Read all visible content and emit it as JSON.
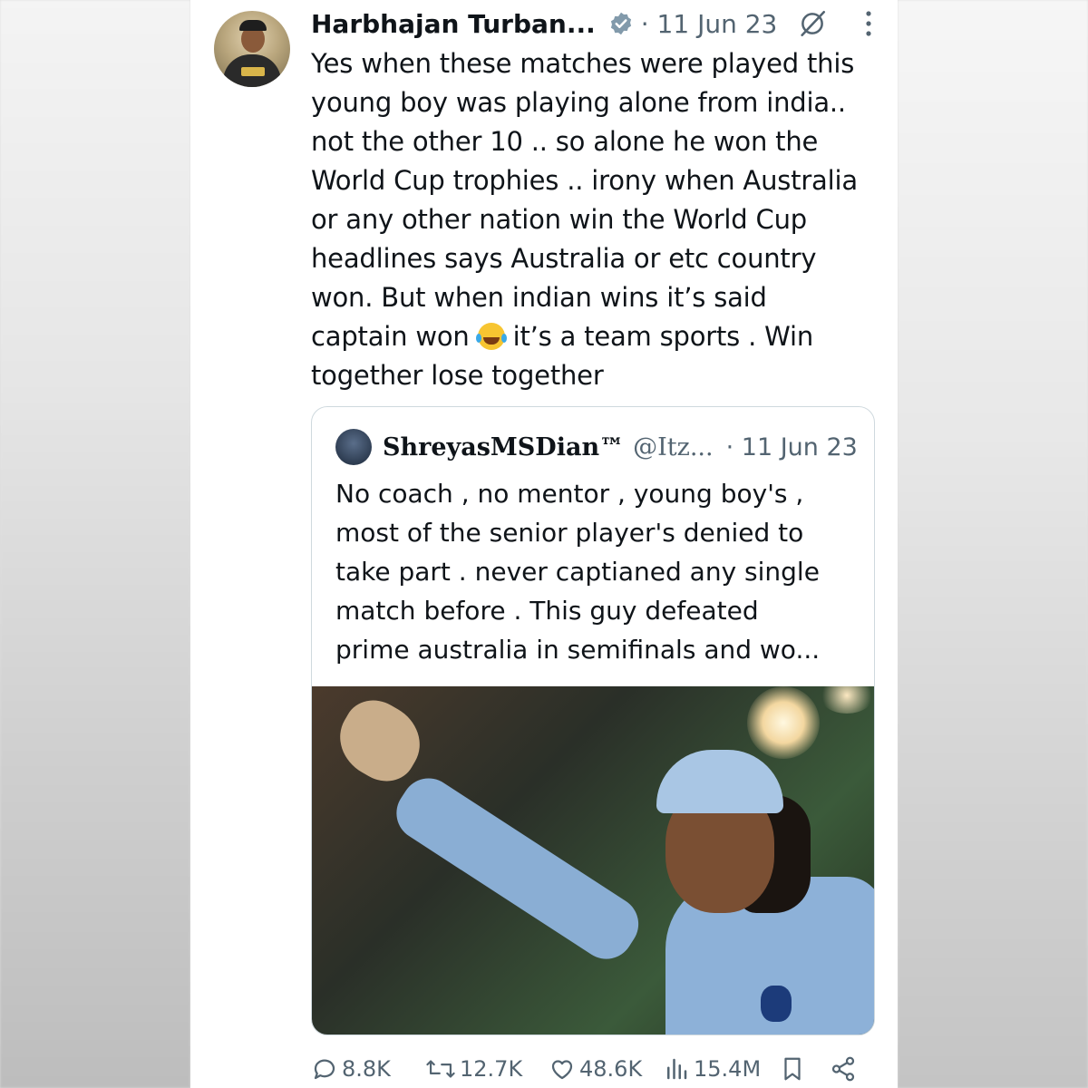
{
  "tweet": {
    "author_name": "Harbhajan Turban...",
    "date": "· 11 Jun 23",
    "text": "Yes when these matches were played this\nyoung boy was playing alone from india..\nnot the other 10 .. so alone he won the\nWorld Cup trophies .. irony when Australia\nor any other nation win the World Cup\nheadlines says Australia or etc country\nwon. But when indian wins it’s said\ncaptain won",
    "text_after_emoji": " it’s a team sports . Win\ntogether lose together"
  },
  "quote": {
    "author_name": "ShreyasMSDian™",
    "handle": "@Itz...",
    "date": "· 11 Jun 23",
    "text": "No coach , no mentor , young boy's  ,\nmost of the senior player's denied to\ntake part . never captianed any single\nmatch before . This guy defeated\nprime australia in semifinals and wo..."
  },
  "actions": {
    "replies": "8.8K",
    "retweets": "12.7K",
    "likes": "48.6K",
    "views": "15.4M"
  },
  "colors": {
    "verified_badge": "#829aab",
    "secondary_text": "#536471",
    "border": "#cfd9de"
  },
  "icons": [
    "verified-icon",
    "grok-icon",
    "more-icon",
    "reply-icon",
    "retweet-icon",
    "like-icon",
    "views-icon",
    "bookmark-icon",
    "share-icon"
  ]
}
